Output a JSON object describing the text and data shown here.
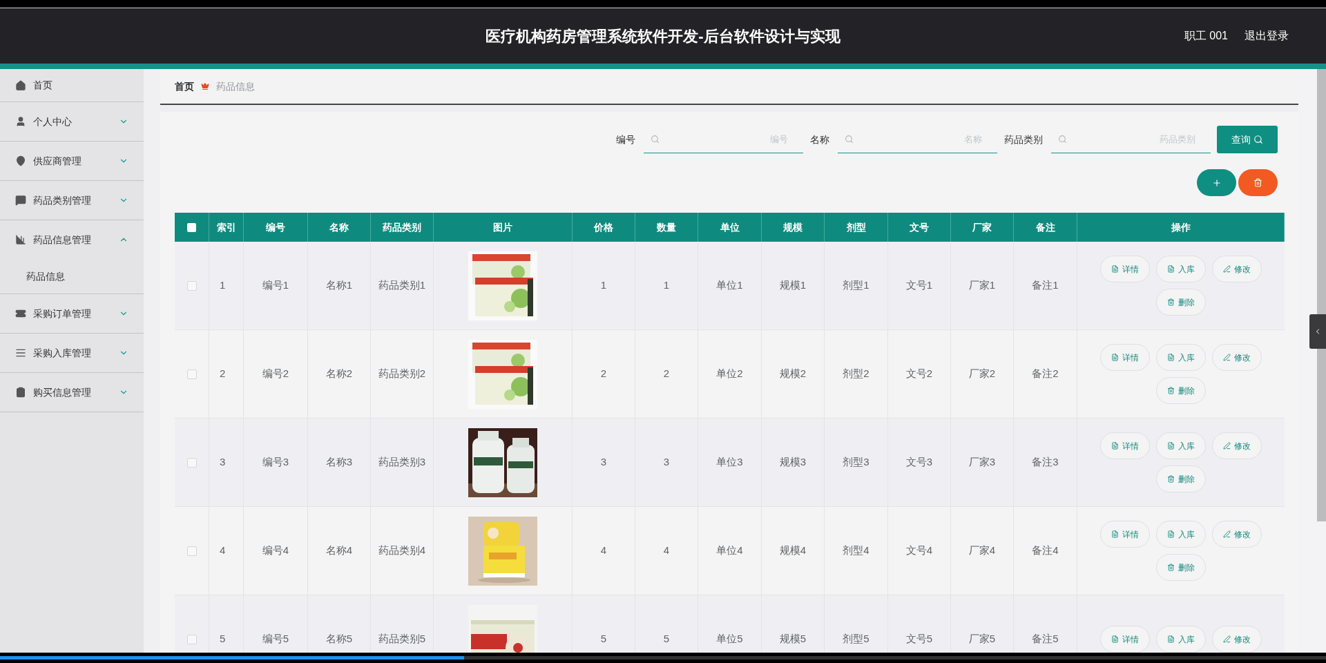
{
  "header": {
    "title": "医疗机构药房管理系统软件开发-后台软件设计与实现",
    "user": "职工 001",
    "logout": "退出登录"
  },
  "sidebar": {
    "items": [
      {
        "label": "首页"
      },
      {
        "label": "个人中心",
        "expanded": false
      },
      {
        "label": "供应商管理",
        "expanded": false
      },
      {
        "label": "药品类别管理",
        "expanded": false
      },
      {
        "label": "药品信息管理",
        "expanded": true,
        "children": [
          {
            "label": "药品信息"
          }
        ]
      },
      {
        "label": "采购订单管理",
        "expanded": false
      },
      {
        "label": "采购入库管理",
        "expanded": false
      },
      {
        "label": "购买信息管理",
        "expanded": false
      }
    ]
  },
  "breadcrumb": [
    "首页",
    "药品信息"
  ],
  "search": {
    "fields": [
      {
        "label": "编号",
        "placeholder": "编号"
      },
      {
        "label": "名称",
        "placeholder": "名称"
      },
      {
        "label": "药品类别",
        "placeholder": "药品类别"
      }
    ],
    "button": "查询"
  },
  "table": {
    "header_checkbox": {
      "checked": false
    },
    "columns": [
      "索引",
      "编号",
      "名称",
      "药品类别",
      "图片",
      "价格",
      "数量",
      "单位",
      "规模",
      "剂型",
      "文号",
      "厂家",
      "备注",
      "操作"
    ],
    "rows": [
      {
        "checked": false,
        "cells": [
          "1",
          "编号1",
          "名称1",
          "药品类别1",
          {
            "kind": "picture"
          },
          "1",
          "1",
          "单位1",
          "规模1",
          "剂型1",
          "文号1",
          "厂家1",
          "备注1"
        ],
        "actions": [
          "详情",
          "入库",
          "修改",
          "删除"
        ]
      },
      {
        "checked": false,
        "cells": [
          "2",
          "编号2",
          "名称2",
          "药品类别2",
          {
            "kind": "picture"
          },
          "2",
          "2",
          "单位2",
          "规模2",
          "剂型2",
          "文号2",
          "厂家2",
          "备注2"
        ],
        "actions": [
          "详情",
          "入库",
          "修改",
          "删除"
        ]
      },
      {
        "checked": false,
        "cells": [
          "3",
          "编号3",
          "名称3",
          "药品类别3",
          {
            "kind": "picture"
          },
          "3",
          "3",
          "单位3",
          "规模3",
          "剂型3",
          "文号3",
          "厂家3",
          "备注3"
        ],
        "actions": [
          "详情",
          "入库",
          "修改",
          "删除"
        ]
      },
      {
        "checked": false,
        "cells": [
          "4",
          "编号4",
          "名称4",
          "药品类别4",
          {
            "kind": "picture"
          },
          "4",
          "4",
          "单位4",
          "规模4",
          "剂型4",
          "文号4",
          "厂家4",
          "备注4"
        ],
        "actions": [
          "详情",
          "入库",
          "修改",
          "删除"
        ]
      },
      {
        "checked": false,
        "cells": [
          "5",
          "编号5",
          "名称5",
          "药品类别5",
          {
            "kind": "picture"
          },
          "5",
          "5",
          "单位5",
          "规模5",
          "剂型5",
          "文号5",
          "厂家5",
          "备注5"
        ],
        "actions": [
          "详情",
          "入库",
          "修改"
        ]
      }
    ]
  },
  "player": {
    "level": 0.35
  }
}
